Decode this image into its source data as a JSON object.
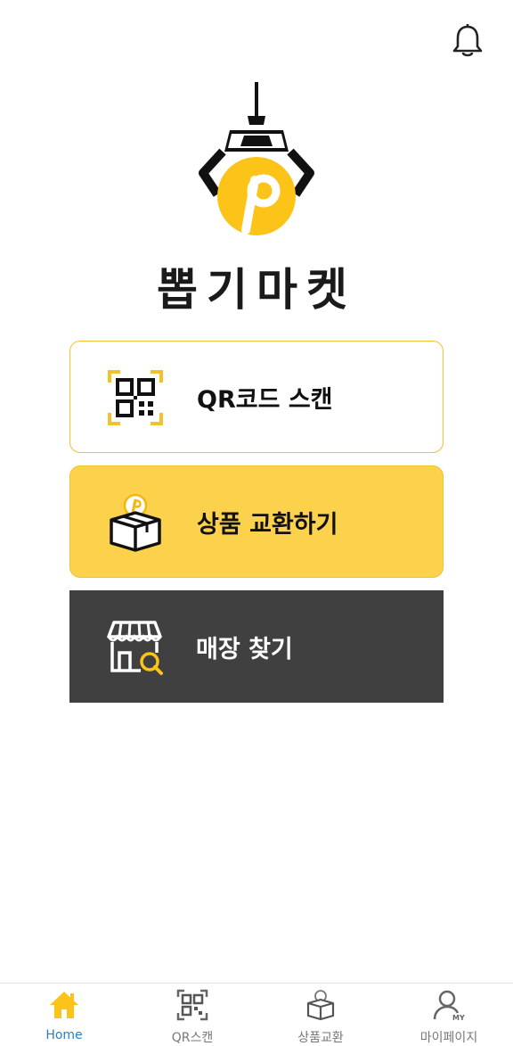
{
  "header": {
    "notification_icon": "bell-icon"
  },
  "brand": {
    "name": "뽑기마켓",
    "logo": "crane-claw-p-coin-logo",
    "accent_color": "#fcc419"
  },
  "menu": [
    {
      "label": "QR코드 스캔",
      "icon": "qr-scan-icon"
    },
    {
      "label": "상품 교환하기",
      "icon": "box-coin-icon"
    },
    {
      "label": "매장 찾기",
      "icon": "store-search-icon"
    }
  ],
  "tabbar": {
    "active": "Home",
    "items": [
      {
        "label": "Home",
        "icon": "home-icon"
      },
      {
        "label": "QR스캔",
        "icon": "qr-icon"
      },
      {
        "label": "상품교환",
        "icon": "box-icon"
      },
      {
        "label": "마이페이지",
        "icon": "user-icon"
      }
    ]
  },
  "colors": {
    "yellow": "#fcd24d",
    "border_yellow": "#f2c12e",
    "dark": "#404040",
    "active_tab": "#2a7fc0"
  }
}
